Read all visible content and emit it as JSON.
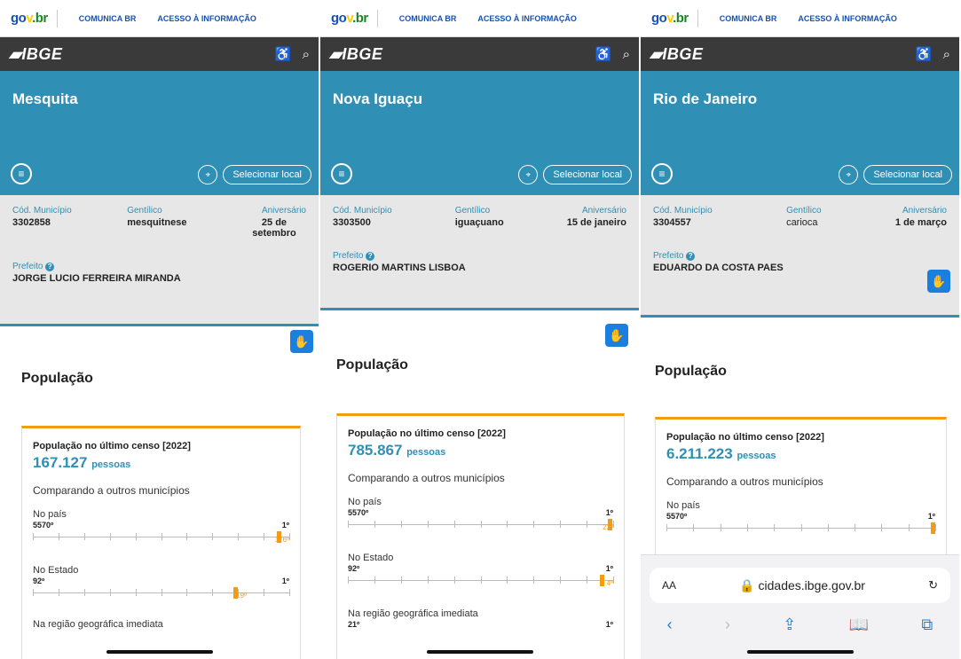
{
  "gov": {
    "logo": "gov.br",
    "link1": "COMUNICA BR",
    "link2": "ACESSO À INFORMAÇÃO"
  },
  "ibge": {
    "logo": "IBGE"
  },
  "common": {
    "select_location": "Selecionar local",
    "cod_label": "Cód. Município",
    "gentilico_label": "Gentílico",
    "aniversario_label": "Aniversário",
    "prefeito_label": "Prefeito",
    "section_title": "População",
    "card_title": "População no último censo [2022]",
    "pessoas": "pessoas",
    "comparando": "Comparando a outros municípios",
    "no_pais": "No país",
    "no_estado": "No Estado",
    "regiao": "Na região geográfica imediata",
    "first": "1º"
  },
  "panels": [
    {
      "city": "Mesquita",
      "cod": "3302858",
      "gentilico": "mesquitnese",
      "aniversario": "25 de setembro",
      "prefeito": "JORGE LUCIO FERREIRA MIRANDA",
      "populacao": "167.127",
      "pais_total": "5570º",
      "pais_pos": "176º",
      "pais_frac": 0.968,
      "estado_total": "92º",
      "estado_pos": "19º",
      "estado_frac": 0.8
    },
    {
      "city": "Nova Iguaçu",
      "cod": "3303500",
      "gentilico": "iguaçuano",
      "aniversario": "15 de janeiro",
      "prefeito": "ROGERIO MARTINS LISBOA",
      "populacao": "785.867",
      "pais_total": "5570º",
      "pais_pos": "23º",
      "pais_frac": 0.996,
      "estado_total": "92º",
      "estado_pos": "4º",
      "estado_frac": 0.967,
      "regiao_total": "21º"
    },
    {
      "city": "Rio de Janeiro",
      "cod": "3304557",
      "gentilico": "carioca",
      "aniversario": "1 de março",
      "prefeito": "EDUARDO DA COSTA PAES",
      "populacao": "6.211.223",
      "pais_total": "5570º",
      "pais_frac": 1.0
    }
  ],
  "safari": {
    "aa": "AA",
    "url": "cidades.ibge.gov.br"
  }
}
